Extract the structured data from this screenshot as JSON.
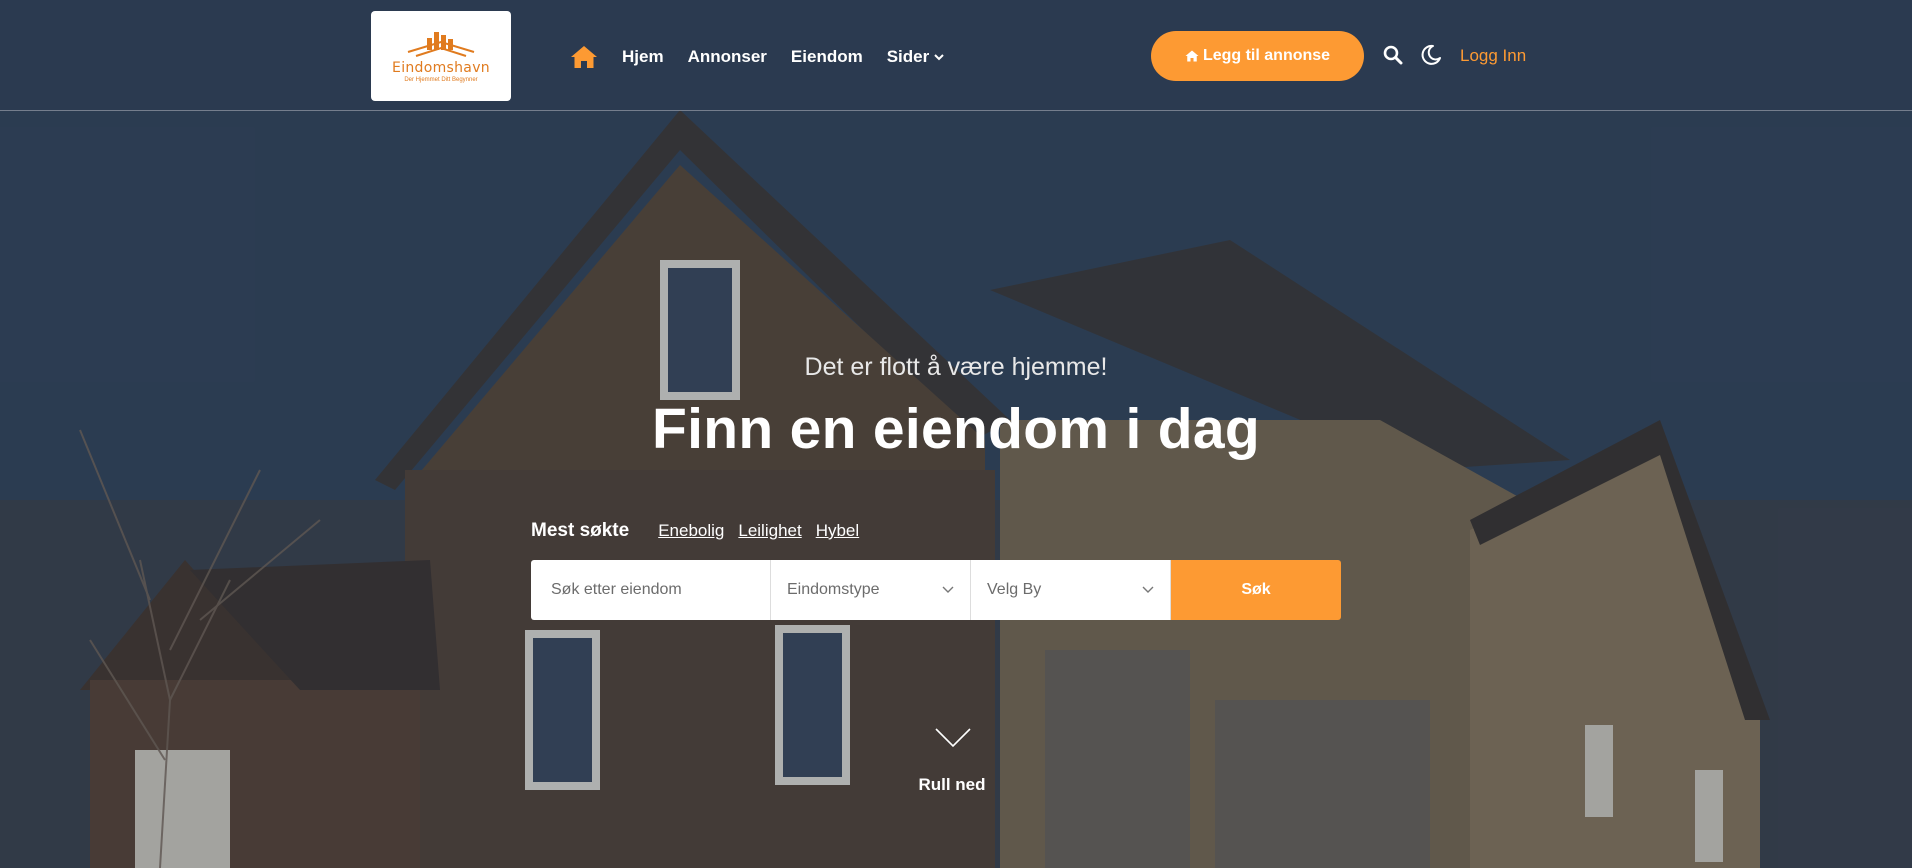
{
  "header": {
    "logo": {
      "name": "Eindomshavn",
      "tagline": "Der Hjemmet Ditt Begynner"
    },
    "nav": [
      {
        "label": "Hjem"
      },
      {
        "label": "Annonser"
      },
      {
        "label": "Eiendom"
      },
      {
        "label": "Sider"
      }
    ],
    "add_listing_label": "Legg til annonse",
    "login_label": "Logg Inn",
    "icons": [
      "home-icon",
      "chevron-down-icon",
      "home-icon",
      "search-icon",
      "moon-icon"
    ]
  },
  "hero": {
    "subtitle": "Det er flott å være hjemme!",
    "title": "Finn en eiendom i dag",
    "popular_label": "Mest søkte",
    "popular_links": [
      "Enebolig",
      "Leilighet",
      "Hybel"
    ],
    "search": {
      "placeholder": "Søk etter eiendom",
      "type_placeholder": "Eindomstype",
      "city_placeholder": "Velg By",
      "button_label": "Søk"
    },
    "scroll_label": "Rull ned"
  },
  "colors": {
    "accent": "#fd9a33",
    "header_bg": "#2c3a50"
  }
}
